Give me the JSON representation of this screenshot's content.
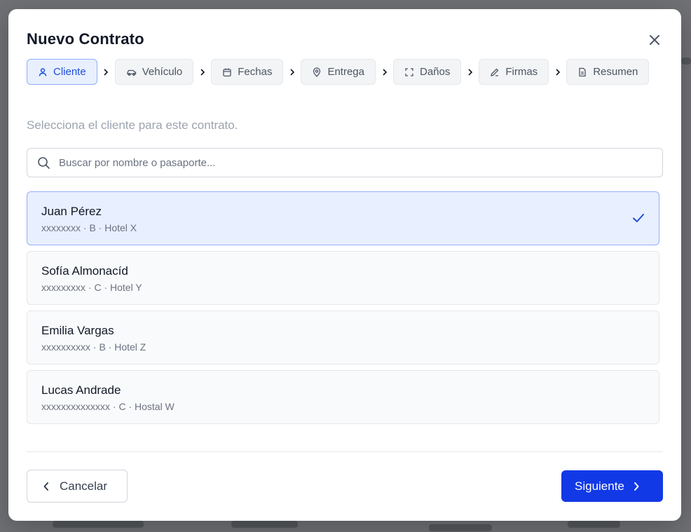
{
  "modal": {
    "title": "Nuevo Contrato",
    "hint": "Selecciona el cliente para este contrato."
  },
  "steps": [
    {
      "label": "Cliente",
      "icon": "user-icon",
      "active": true
    },
    {
      "label": "Vehículo",
      "icon": "car-icon",
      "active": false
    },
    {
      "label": "Fechas",
      "icon": "calendar-icon",
      "active": false
    },
    {
      "label": "Entrega",
      "icon": "map-pin-icon",
      "active": false
    },
    {
      "label": "Daños",
      "icon": "scan-icon",
      "active": false
    },
    {
      "label": "Firmas",
      "icon": "pen-icon",
      "active": false
    },
    {
      "label": "Resumen",
      "icon": "file-text-icon",
      "active": false
    }
  ],
  "search": {
    "placeholder": "Buscar por nombre o pasaporte...",
    "value": ""
  },
  "clients": [
    {
      "name": "Juan Pérez",
      "meta": "xxxxxxxx · B · Hotel X",
      "selected": true
    },
    {
      "name": "Sofía Almonacíd",
      "meta": "xxxxxxxxx · C · Hotel Y",
      "selected": false
    },
    {
      "name": "Emilia Vargas",
      "meta": "xxxxxxxxxx · B · Hotel Z",
      "selected": false
    },
    {
      "name": "Lucas Andrade",
      "meta": "xxxxxxxxxxxxxx · C · Hostal W",
      "selected": false
    }
  ],
  "footer": {
    "cancel_label": "Cancelar",
    "next_label": "Siguiente"
  },
  "colors": {
    "accent": "#1239e6",
    "active_bg": "#e8efff",
    "active_border": "#93aef7"
  }
}
